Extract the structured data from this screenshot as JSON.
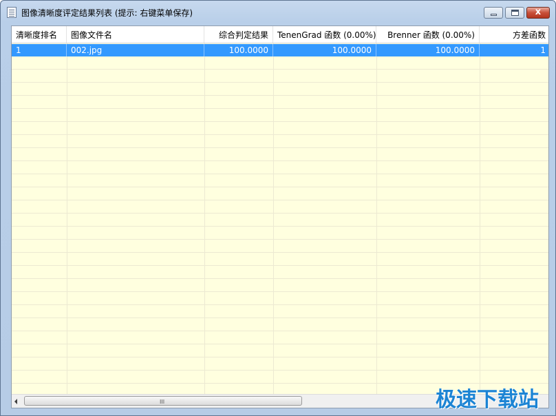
{
  "window": {
    "title": "图像清晰度评定结果列表 (提示: 右键菜单保存)",
    "controls": {
      "minimize": "",
      "maximize": "",
      "close": "x"
    }
  },
  "table": {
    "columns": [
      "清晰度排名",
      "图像文件名",
      "综合判定结果",
      "TenenGrad 函数 (0.00%)",
      "Brenner 函数 (0.00%)",
      "方差函数"
    ],
    "rows": [
      [
        "1",
        "002.jpg",
        "100.0000",
        "100.0000",
        "100.0000",
        "1"
      ]
    ],
    "selected_row": 0
  },
  "scrollbar": {
    "grip": "III"
  },
  "watermark": {
    "text": "极速下载站"
  },
  "colors": {
    "selection": "#3399ff",
    "list_background": "#ffffdf",
    "watermark": "#1c84d4"
  }
}
